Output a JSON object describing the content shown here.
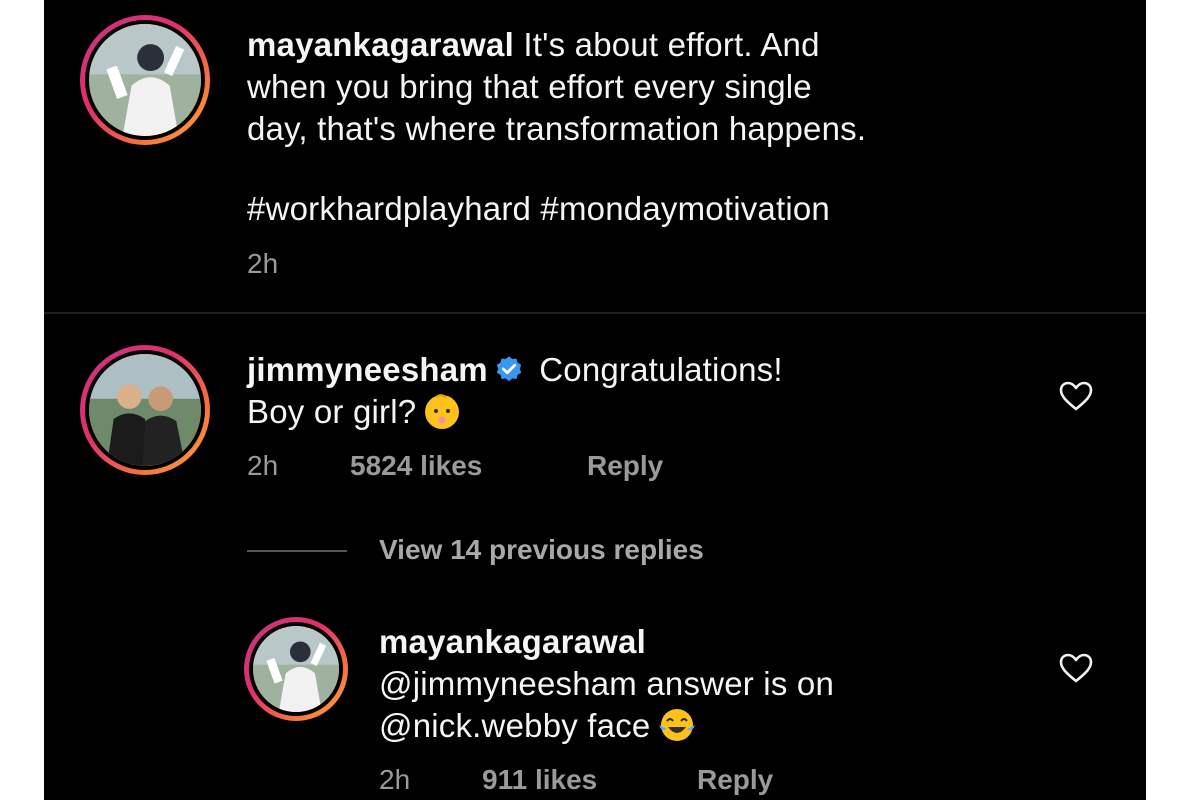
{
  "post": {
    "username": "mayankagarawal",
    "caption_line1": "It's about effort. And",
    "caption_line2": "when you bring that effort every single",
    "caption_line3": "day, that's where transformation happens.",
    "hashtags": "#workhardplayhard #mondaymotivation",
    "time": "2h"
  },
  "comment": {
    "username": "jimmyneesham",
    "verified": true,
    "text_line1": "Congratulations!",
    "text_line2": "Boy or girl?",
    "emoji": "baby-emoji",
    "time": "2h",
    "likes": "5824 likes",
    "reply_label": "Reply"
  },
  "view_replies": "View 14 previous replies",
  "reply": {
    "username": "mayankagarawal",
    "text_line1": "@jimmyneesham answer is on",
    "text_line2": "@nick.webby face",
    "emoji": "tears-of-joy-emoji",
    "time": "2h",
    "likes": "911 likes",
    "reply_label": "Reply"
  },
  "colors": {
    "background": "#000000",
    "text": "#f5f5f5",
    "muted": "#9a9a9a",
    "verified_blue": "#3897f0"
  }
}
